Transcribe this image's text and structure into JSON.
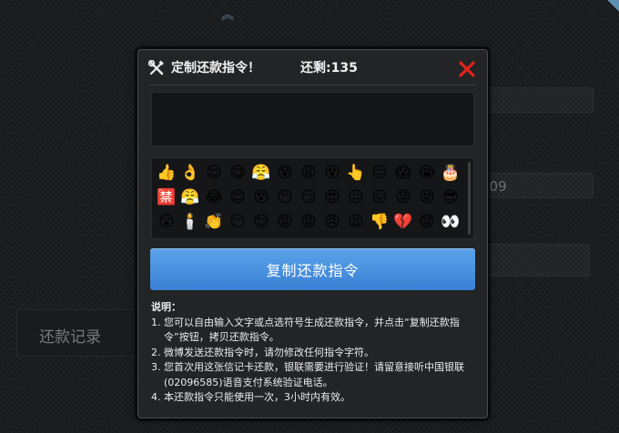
{
  "background": {
    "partial_number": "209",
    "record_label": "还款记录"
  },
  "modal": {
    "title": "定制还款指令！",
    "remaining": "还剩:135",
    "input_value": "",
    "copy_button_label": "复制还款指令",
    "notes_label": "说明：",
    "notes": [
      {
        "num": "1.",
        "text": "您可以自由输入文字或点选符号生成还款指令，并点击“复制还款指令”按钮，拷贝还款指令。"
      },
      {
        "num": "2.",
        "text": "微博发送还款指令时，请勿修改任何指令字符。"
      },
      {
        "num": "3.",
        "text": "您首次用这张信记卡还款，银联需要进行验证！请留意接听中国银联(02096585)语音支付系统验证电话。"
      },
      {
        "num": "4.",
        "text": "本还款指令只能使用一次，3小时内有效。"
      }
    ],
    "emojis": [
      "👍",
      "👌",
      "😌",
      "😋",
      "😤",
      "😰",
      "😩",
      "😵",
      "👆",
      "😐",
      "😱",
      "😭",
      "🎂",
      "🈲",
      "😤",
      "😂",
      "😊",
      "😵",
      "😶",
      "😏",
      "😍",
      "😐",
      "😖",
      "😟",
      "😝",
      "😎",
      "😮",
      "🕯️",
      "👏",
      "😶",
      "😌",
      "😡",
      "😡",
      "😠",
      "😫",
      "👎",
      "💔",
      "😟",
      "👀"
    ]
  },
  "colors": {
    "accent_button": "#4a92e0",
    "close_icon": "#e0231c",
    "background": "#1c1d1f"
  }
}
